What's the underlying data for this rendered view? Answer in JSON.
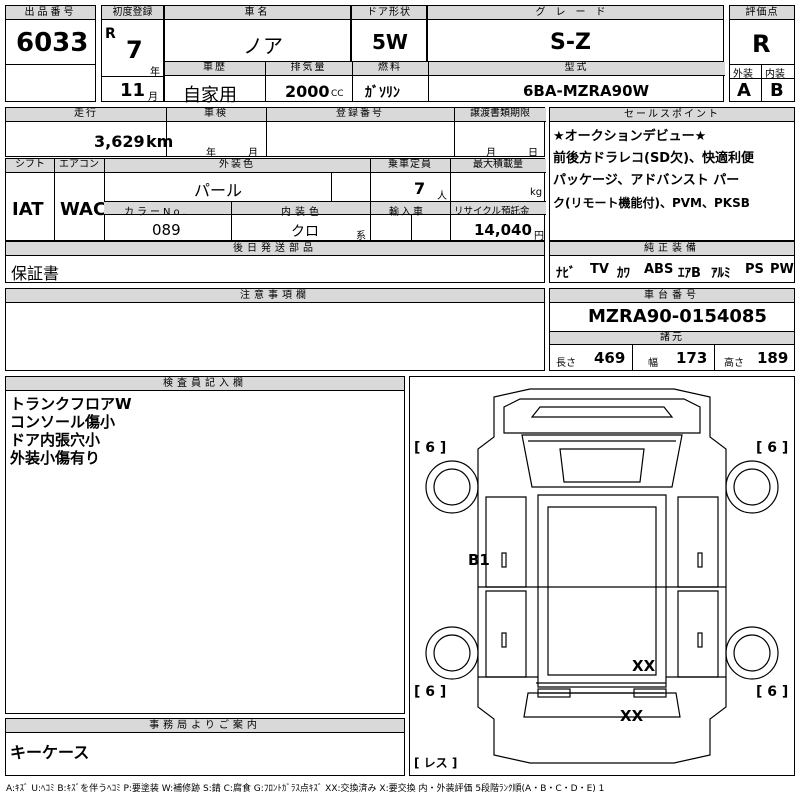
{
  "lot": {
    "label": "出品番号",
    "value": "6033"
  },
  "first_reg": {
    "label": "初度登録",
    "era": "R",
    "year": "7",
    "year_unit": "年",
    "month": "11",
    "month_unit": "月"
  },
  "car_name": {
    "label": "車名",
    "value": "ノア"
  },
  "doors": {
    "label": "ドア形状",
    "value": "5W"
  },
  "grade": {
    "label": "グレード",
    "value": "S-Z"
  },
  "score": {
    "label": "評価点",
    "value": "R"
  },
  "history": {
    "label": "車歴",
    "value": "自家用"
  },
  "displacement": {
    "label": "排気量",
    "value": "2000",
    "unit": "CC"
  },
  "fuel": {
    "label": "燃料",
    "value": "ｶﾞｿﾘﾝ"
  },
  "model_code": {
    "label": "型式",
    "value": "6BA-MZRA90W"
  },
  "ext_score": {
    "label": "外装",
    "value": "A"
  },
  "int_score": {
    "label": "内装",
    "value": "B"
  },
  "mileage": {
    "label": "走行",
    "value": "3,629",
    "unit": "km"
  },
  "inspection": {
    "label": "車検",
    "year_unit": "年",
    "month_unit": "月"
  },
  "reg_no": {
    "label": "登録番号"
  },
  "transfer": {
    "label": "譲渡書類期限",
    "month_unit": "月",
    "day_unit": "日"
  },
  "selling": {
    "label": "セールスポイント",
    "lines": [
      "★オークションデビュー★",
      "前後方ドラレコ(SD欠)、快適利便",
      "パッケージ、アドバンスト パー",
      "ク(リモート機能付)、PVM、PKSB"
    ]
  },
  "shift": {
    "label": "シフト",
    "value": "IAT"
  },
  "ac": {
    "label": "エアコン",
    "value": "WAC"
  },
  "ext_color": {
    "label": "外装色",
    "value": "パール"
  },
  "capacity": {
    "label": "乗車定員",
    "value": "7",
    "unit": "人"
  },
  "max_load": {
    "label": "最大積載量",
    "unit": "kg"
  },
  "color_no": {
    "label": "カラーNo.",
    "value": "089"
  },
  "int_color": {
    "label": "内装色",
    "value": "クロ",
    "unit": "系"
  },
  "import": {
    "label": "輸入車"
  },
  "recycle": {
    "label": "リサイクル預託金",
    "value": "14,040",
    "unit": "円"
  },
  "later_parts": {
    "label": "後日発送部品",
    "value": "保証書"
  },
  "equipment": {
    "label": "純正装備",
    "items": [
      "ﾅﾋﾞ",
      "TV",
      "ｶﾜ",
      "ABS",
      "ｴｱB",
      "ｱﾙﾐ",
      "PS",
      "PW"
    ]
  },
  "notes": {
    "label": "注意事項欄"
  },
  "chassis": {
    "label": "車台番号",
    "value": "MZRA90-0154085"
  },
  "specs": {
    "label": "諸元",
    "length_label": "長さ",
    "length": "469",
    "width_label": "幅",
    "width": "173",
    "height_label": "高さ",
    "height": "189"
  },
  "inspector": {
    "label": "検査員記入欄",
    "lines": [
      "トランクフロアW",
      "コンソール傷小",
      "ドア内張穴小",
      "外装小傷有り"
    ]
  },
  "diagram": {
    "tire_fl": "6",
    "tire_fr": "6",
    "tire_rl": "6",
    "tire_rr": "6",
    "mark_b1": "B1",
    "mark_xx1": "XX",
    "mark_xx2": "XX",
    "spare_label": "レス"
  },
  "office": {
    "label": "事務局よりご案内",
    "value": "キーケース"
  },
  "legend": "A:ｷｽﾞ U:ﾍｺﾐ B:ｷｽﾞを伴うﾍｺﾐ P:要塗装 W:補修跡 S:錆 C:腐食 G:ﾌﾛﾝﾄｶﾞﾗｽ点ｷｽﾞ XX:交換済み X:要交換 内・外装評価 5段階ﾗﾝｸ順(A・B・C・D・E) 1"
}
